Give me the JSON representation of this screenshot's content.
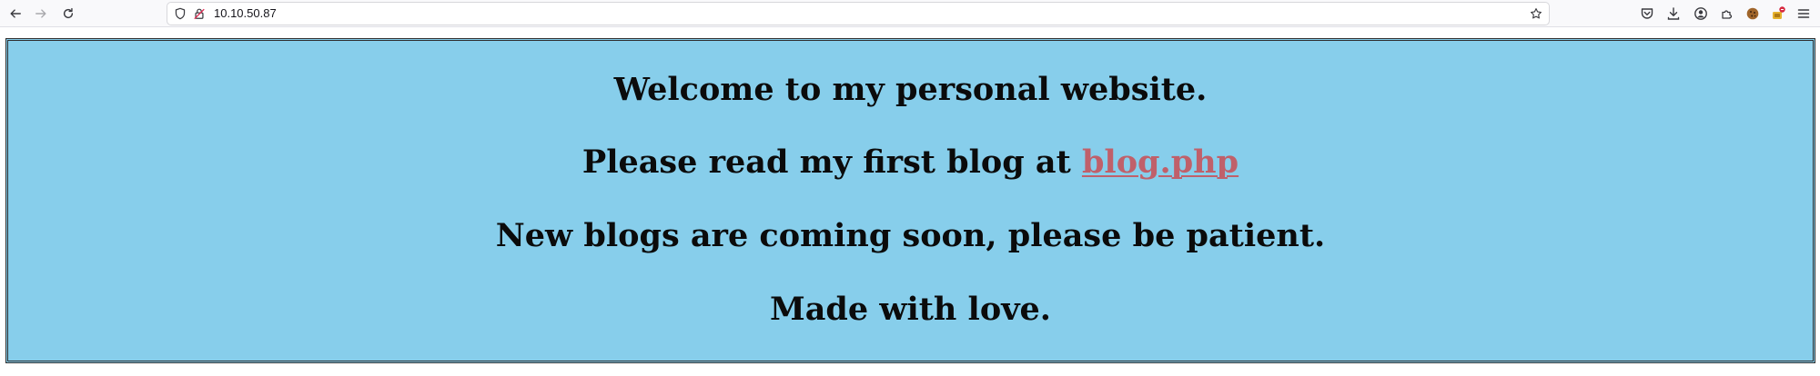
{
  "browser": {
    "url": "10.10.50.87",
    "icons": {
      "back": "arrow-left-icon",
      "forward": "arrow-right-icon",
      "reload": "reload-icon",
      "shield": "shield-icon",
      "site_info": "site-info-icon",
      "bookmark": "star-icon",
      "pocket": "pocket-icon",
      "downloads": "download-icon",
      "account": "account-icon",
      "extensions": "extensions-icon",
      "cookie": "cookie-icon",
      "extension_badge": "extension-badge-icon",
      "menu": "hamburger-menu-icon"
    }
  },
  "page": {
    "background_color": "#87ceeb",
    "link_color": "#c0606a",
    "welcome": "Welcome to my personal website.",
    "blog_prefix": "Please read my first blog at ",
    "blog_link": "blog.php",
    "coming_soon": "New blogs are coming soon, please be patient.",
    "made_with": "Made with love."
  }
}
